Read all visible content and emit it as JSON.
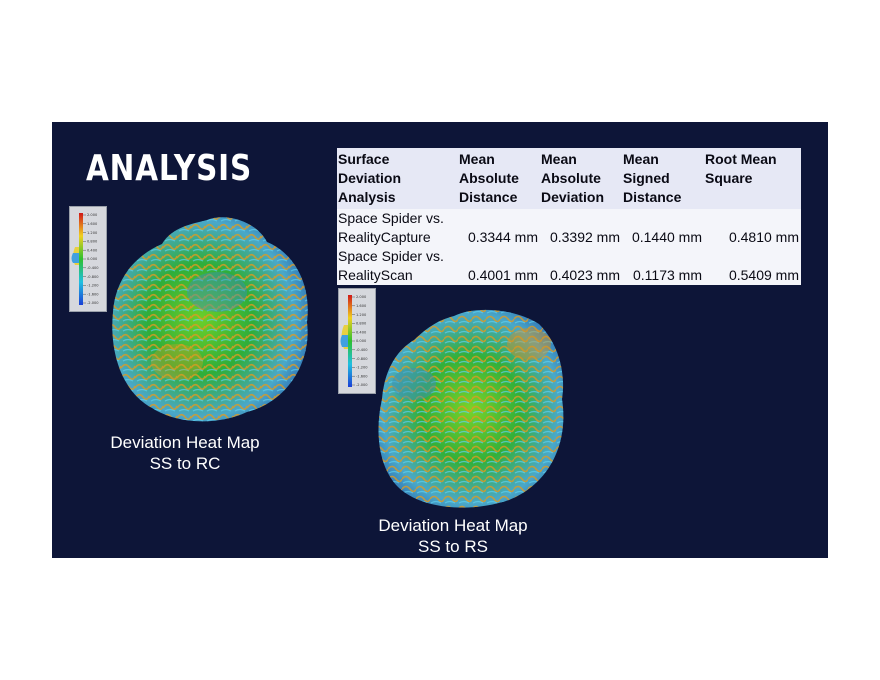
{
  "slide": {
    "title": "ANALYSIS",
    "background": "#0d1538"
  },
  "table": {
    "headers": [
      "Surface Deviation Analysis",
      "Mean Absolute Distance",
      "Mean Absolute Deviation",
      "Mean Signed Distance",
      "Root Mean Square"
    ],
    "rows": [
      {
        "label": "Space Spider vs. RealityCapture",
        "values": [
          "0.3344 mm",
          "0.3392 mm",
          "0.1440 mm",
          "0.4810 mm"
        ]
      },
      {
        "label": "Space Spider vs. RealityScan",
        "values": [
          "0.4001 mm",
          "0.4023 mm",
          "0.1173 mm",
          "0.5409 mm"
        ]
      }
    ]
  },
  "figures": [
    {
      "caption_line1": "Deviation Heat Map",
      "caption_line2": "SS to RC",
      "legend_ticks": [
        "2.000",
        "1.600",
        "1.200",
        "0.800",
        "0.400",
        "0.000",
        "-0.400",
        "-0.800",
        "-1.200",
        "-1.600",
        "-2.000"
      ]
    },
    {
      "caption_line1": "Deviation Heat Map",
      "caption_line2": "SS to RS",
      "legend_ticks": [
        "2.000",
        "1.600",
        "1.200",
        "0.800",
        "0.400",
        "0.000",
        "-0.400",
        "-0.800",
        "-1.200",
        "-1.600",
        "-2.000"
      ]
    }
  ],
  "colors": {
    "scale_high": "#d01818",
    "scale_mid": "#2ec02e",
    "scale_low": "#1a3fd6",
    "table_header": "#e6e8f5",
    "table_body": "#f4f5fa"
  }
}
